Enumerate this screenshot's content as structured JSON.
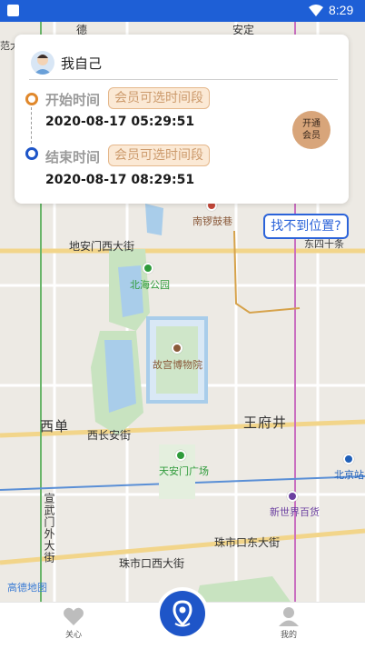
{
  "status_bar": {
    "time": "8:29"
  },
  "card": {
    "user_name": "我自己",
    "start_label": "开始时间",
    "start_tag": "会员可选时间段",
    "start_time": "2020-08-17 05:29:51",
    "end_label": "结束时间",
    "end_tag": "会员可选时间段",
    "end_time": "2020-08-17 08:29:51",
    "member_button": [
      "开通",
      "会员"
    ]
  },
  "locate_button": "找不到位置?",
  "map": {
    "pois": [
      "南锣鼓巷",
      "北海公园",
      "故宫博物院",
      "天安门广场",
      "新世界百货",
      "北京站",
      "东四十条",
      "范大"
    ],
    "roads": [
      "地安门西大街",
      "西长安街",
      "西单",
      "王府井",
      "宣武门外大街",
      "珠市口西大街",
      "珠市口东大街",
      "安定",
      "德"
    ],
    "logo": "高德地图"
  },
  "tabbar": {
    "left_label": "关心",
    "right_label": "我的"
  },
  "colors": {
    "primary": "#1e55c8",
    "accent_orange": "#e0882c",
    "member_gold": "#d8a57a"
  }
}
